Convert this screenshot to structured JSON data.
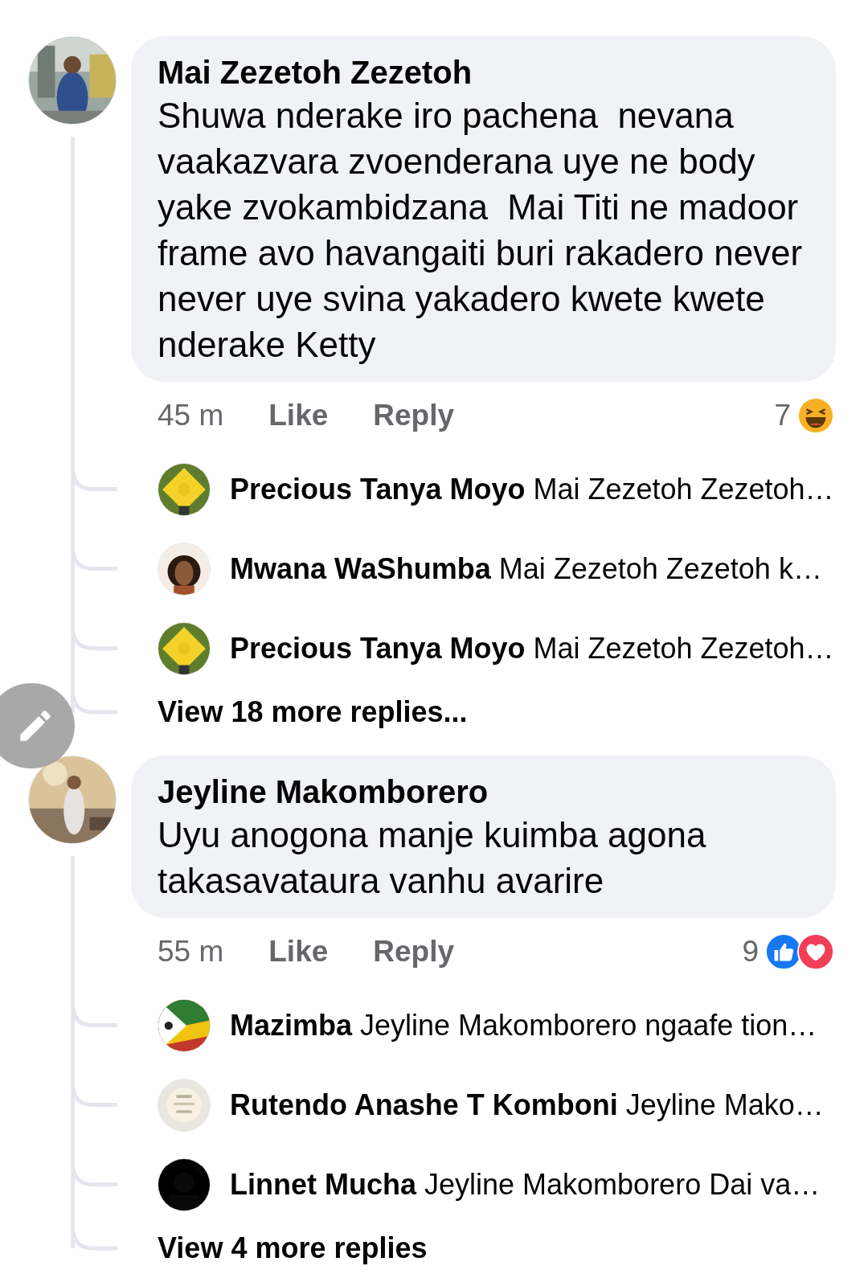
{
  "comments": [
    {
      "author": "Mai Zezetoh Zezetoh",
      "text": "Shuwa nderake iro pachena  nevana vaakazvara zvoenderana uye ne body yake zvokambidzana  Mai Titi ne madoor frame avo havangaiti buri rakadero never never uye svina yakadero kwete kwete nderake Ketty",
      "time": "45 m",
      "like": "Like",
      "reply": "Reply",
      "reaction_count": "7",
      "reactions": [
        {
          "kind": "haha"
        }
      ],
      "replies": [
        {
          "text": "**Precious Tanya Moyo** Mai Zezetoh Zezetoh…"
        },
        {
          "text": "**Mwana WaShumba** Mai Zezetoh Zezetoh k…"
        },
        {
          "text": "**Precious Tanya Moyo** Mai Zezetoh Zezetoh…"
        }
      ],
      "more": "View 18 more replies..."
    },
    {
      "author": "Jeyline Makomborero",
      "text": "Uyu anogona manje kuimba agona takasavataura vanhu avarire",
      "time": "55 m",
      "like": "Like",
      "reply": "Reply",
      "reaction_count": "9",
      "reactions": [
        {
          "kind": "like"
        },
        {
          "kind": "love"
        }
      ],
      "replies": [
        {
          "text": "**Mazimba** Jeyline Makomborero ngaafe tion…"
        },
        {
          "text": "**Rutendo Anashe T Komboni** Jeyline Mako…"
        },
        {
          "text": "**Linnet Mucha** Jeyline Makomborero Dai va…"
        }
      ],
      "more": "View 4 more replies"
    }
  ]
}
